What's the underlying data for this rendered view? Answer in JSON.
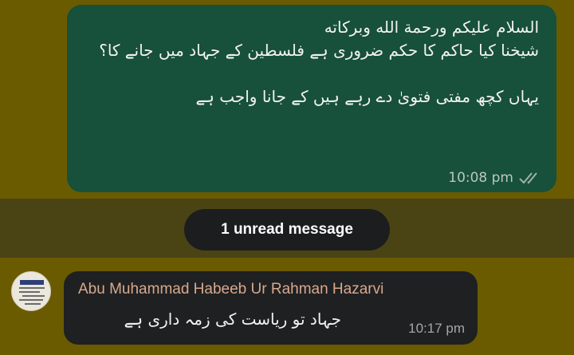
{
  "outgoing_message": {
    "lines": [
      "السلام علیکم ورحمة الله وبركاته",
      "شیخنا کیا حاکم کا حکم ضروری ہے فلسطین کے جہاد میں جانے کا؟",
      "یہاں کچھ مفتی فتویٰ دے رہے ہیں کے جانا واجب ہے"
    ],
    "time": "10:08 pm",
    "status_icon": "double-check-icon"
  },
  "unread_divider": {
    "label": "1 unread message"
  },
  "incoming_message": {
    "sender": "Abu Muhammad Habeeb Ur Rahman Hazarvi",
    "text": "جہاد تو ریاست کی زمہ داری ہے",
    "time": "10:17 pm",
    "avatar_icon": "avatar-image"
  },
  "colors": {
    "wallpaper": "#6b5b00",
    "outgoing_bubble": "#17503b",
    "incoming_bubble": "#1f2022",
    "sender_name": "#d9a98d",
    "unread_band": "#4a4314"
  }
}
